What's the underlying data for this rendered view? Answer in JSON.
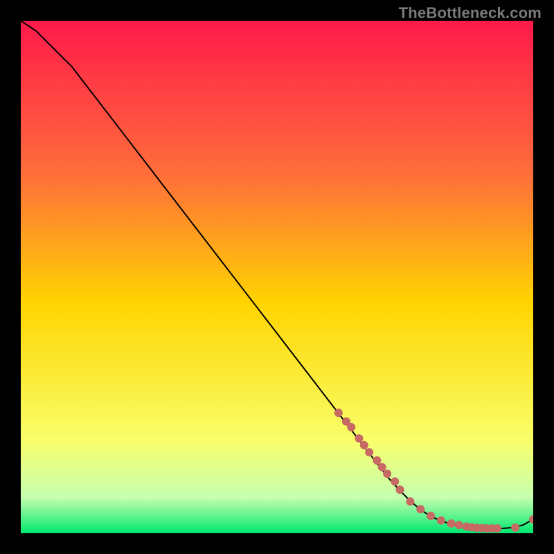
{
  "watermark": "TheBottleneck.com",
  "colors": {
    "background": "#000000",
    "gradient_top": "#ff1a4b",
    "gradient_mid_upper": "#ff6e3a",
    "gradient_mid": "#ffd400",
    "gradient_mid_lower": "#f8ff6a",
    "gradient_near_bottom": "#c6ffb0",
    "gradient_bottom": "#00e86f",
    "curve": "#000000",
    "points": "#c66a63",
    "watermark": "#7a7a7a"
  },
  "chart_data": {
    "type": "line",
    "title": "",
    "xlabel": "",
    "ylabel": "",
    "xlim": [
      0,
      100
    ],
    "ylim": [
      0,
      100
    ],
    "grid": false,
    "legend": null,
    "series": [
      {
        "name": "curve",
        "kind": "line",
        "x": [
          0,
          3,
          6,
          10,
          15,
          20,
          25,
          30,
          35,
          40,
          45,
          50,
          55,
          60,
          62,
          64,
          66,
          68,
          70,
          72,
          74,
          76,
          78,
          80,
          82,
          84,
          86,
          88,
          90,
          92,
          94,
          96,
          98,
          100
        ],
        "y": [
          100,
          98,
          95,
          91,
          84.5,
          78,
          71.5,
          65,
          58.5,
          52,
          45.5,
          39,
          32.5,
          26,
          23.4,
          20.8,
          18.2,
          15.6,
          13,
          10.5,
          8.3,
          6.3,
          4.6,
          3.3,
          2.4,
          1.8,
          1.4,
          1.15,
          1.0,
          0.95,
          0.95,
          1.1,
          1.6,
          2.7
        ]
      },
      {
        "name": "scatter-points",
        "kind": "scatter",
        "x": [
          62,
          63.5,
          64.5,
          66,
          67,
          68,
          69.5,
          70.5,
          71.5,
          73,
          74,
          76,
          78,
          80,
          82,
          84,
          85.5,
          87,
          88,
          89,
          90,
          91,
          92,
          93,
          96.5,
          100
        ],
        "y": [
          23.5,
          21.8,
          20.7,
          18.5,
          17.2,
          15.8,
          14.2,
          12.9,
          11.6,
          10.1,
          8.5,
          6.2,
          4.7,
          3.4,
          2.5,
          1.9,
          1.6,
          1.3,
          1.15,
          1.05,
          1.0,
          0.95,
          0.95,
          0.95,
          1.1,
          2.7
        ]
      }
    ]
  }
}
